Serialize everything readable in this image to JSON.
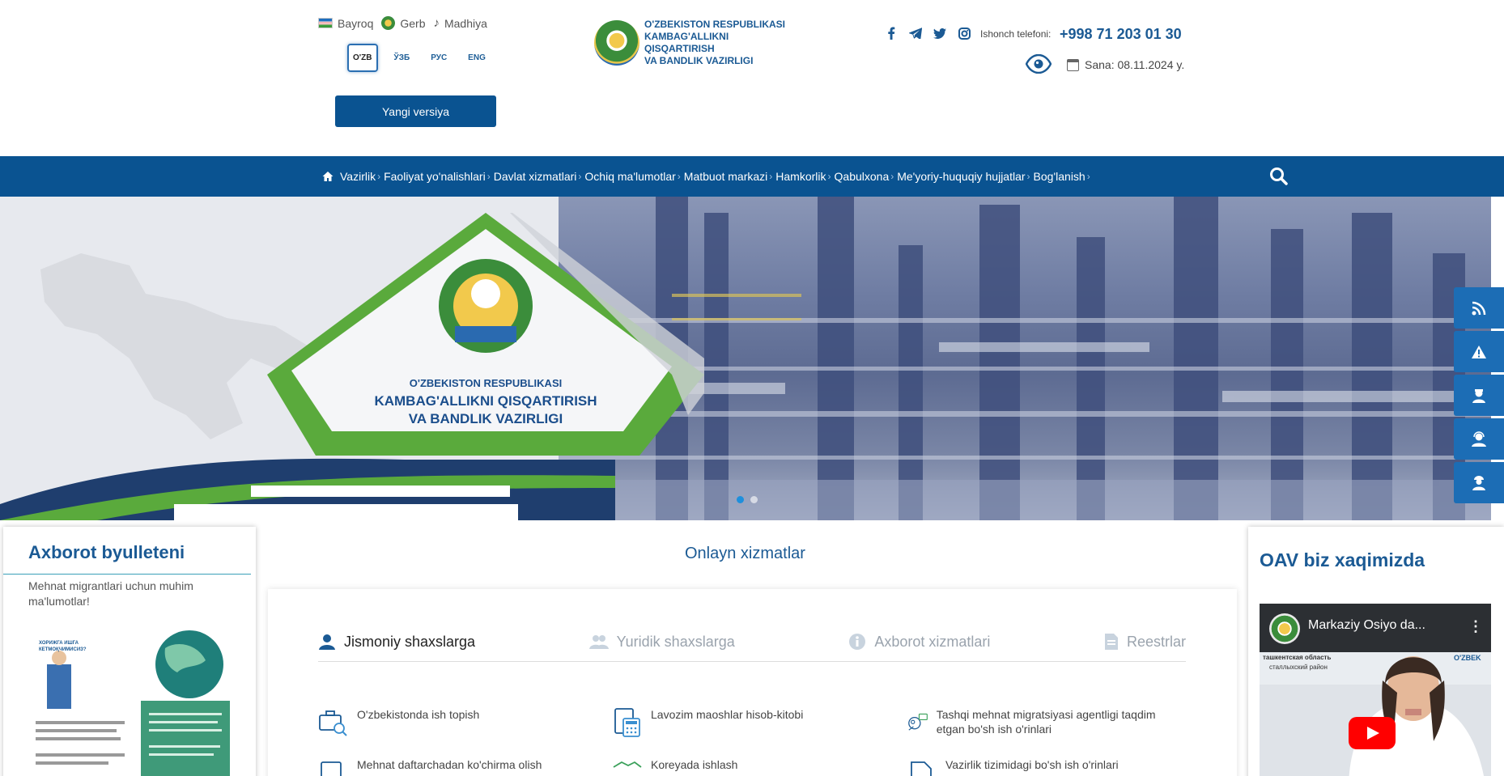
{
  "header": {
    "symbols": [
      {
        "label": "Bayroq",
        "icon": "flag-icon"
      },
      {
        "label": "Gerb",
        "icon": "emblem-icon"
      },
      {
        "label": "Madhiya",
        "icon": "music-note-icon"
      }
    ],
    "languages": [
      "O'ZB",
      "ЎЗБ",
      "РУС",
      "ENG"
    ],
    "active_language": "O'ZB",
    "new_version_label": "Yangi versiya",
    "brand": {
      "line1": "O'ZBEKISTON RESPUBLIKASI",
      "line2": "KAMBAG'ALLIKNI QISQARTIRISH",
      "line3": "VA BANDLIK VAZIRLIGI"
    },
    "social_icons": [
      "facebook-icon",
      "telegram-icon",
      "twitter-icon",
      "instagram-icon"
    ],
    "hotline_label": "Ishonch telefoni:",
    "hotline_number": "+998 71 203 01 30",
    "date_label": "Sana: 08.11.2024 y."
  },
  "nav": {
    "items": [
      "Vazirlik",
      "Faoliyat yo'nalishlari",
      "Davlat xizmatlari",
      "Ochiq ma'lumotlar",
      "Matbuot markazi",
      "Hamkorlik",
      "Qabulxona",
      "Me'yoriy-huquqiy hujjatlar",
      "Bog'lanish"
    ]
  },
  "banner": {
    "line1": "O'ZBEKISTON RESPUBLIKASI",
    "line2": "KAMBAG'ALLIKNI QISQARTIRISH",
    "line3": "VA BANDLIK  VAZIRLIGI",
    "slides": 2,
    "active_slide": 1
  },
  "side_widgets": [
    "rss-icon",
    "warning-icon",
    "person-cap-icon",
    "person-headset-icon",
    "person-worker-icon"
  ],
  "left": {
    "title": "Axborot byulleteni",
    "subtitle": "Mehnat migrantlari uchun muhim ma'lumotlar!",
    "booklet_heading": "ХОРИЖГА ИШГА КЕТМОҚЧИМИСИЗ?"
  },
  "center": {
    "title": "Onlayn xizmatlar",
    "tabs": [
      {
        "label": "Jismoniy shaxslarga",
        "icon": "person-icon"
      },
      {
        "label": "Yuridik shaxslarga",
        "icon": "people-icon"
      },
      {
        "label": "Axborot xizmatlari",
        "icon": "info-icon"
      },
      {
        "label": "Reestrlar",
        "icon": "document-icon"
      }
    ],
    "services": [
      {
        "label": "O'zbekistonda ish topish",
        "icon": "briefcase-search-icon"
      },
      {
        "label": "Lavozim maoshlar hisob-kitobi",
        "icon": "calculator-icon"
      },
      {
        "label": "Tashqi mehnat migratsiyasi agentligi taqdim etgan bo'sh ish o'rinlari",
        "icon": "migration-icon"
      },
      {
        "label": "Mehnat daftarchadan ko'chirma olish",
        "icon": "workbook-icon"
      },
      {
        "label": "Koreyada ishlash",
        "icon": "handshake-icon"
      },
      {
        "label": "Vazirlik tizimidagi bo'sh ish o'rinlari",
        "icon": "document-icon"
      }
    ]
  },
  "right": {
    "title": "OAV biz xaqimizda",
    "video_title": "Markaziy Osiyo da...",
    "video_overlay_ru": "ташкентская область",
    "video_overlay_ru2": "сталлыхский район",
    "video_overlay_uz": "O'ZBEK"
  }
}
